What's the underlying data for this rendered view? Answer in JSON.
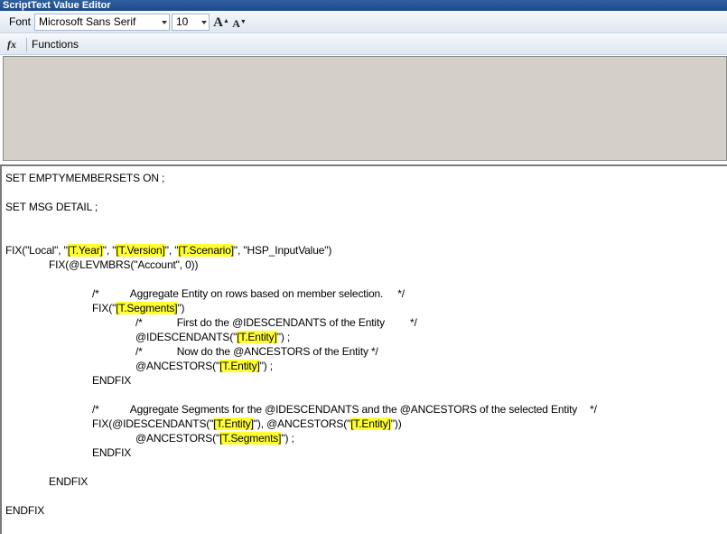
{
  "window": {
    "title": "ScriptText Value Editor"
  },
  "toolbar": {
    "font_label": "Font",
    "font_name": "Microsoft Sans Serif",
    "font_size": "10",
    "grow_label": "A",
    "shrink_label": "A",
    "fx_label": "fx",
    "functions_label": "Functions"
  },
  "script": {
    "l1": "SET EMPTYMEMBERSETS ON ;",
    "l2": "SET MSG DETAIL ;",
    "l3_a": "FIX(\"Local\", \"",
    "l3_b": "[T.Year]",
    "l3_c": "\", \"",
    "l3_d": "[T.Version]",
    "l3_e": "\", \"",
    "l3_f": "[T.Scenario]",
    "l3_g": "\", \"HSP_InputValue\")",
    "l4": "FIX(@LEVMBRS(\"Account\", 0))",
    "l5_a": "/*",
    "l5_b": "Aggregate Entity on rows based on member selection.",
    "l5_c": "*/",
    "l6_a": "FIX(\"",
    "l6_b": "[T.Segments]",
    "l6_c": "\")",
    "l7_a": "/*",
    "l7_b": "First do the @IDESCENDANTS of the Entity",
    "l7_c": "*/",
    "l8_a": "@IDESCENDANTS(\"",
    "l8_b": "[T.Entity]",
    "l8_c": "\") ;",
    "l9_a": "/*",
    "l9_b": "Now do the @ANCESTORS of the Entity */",
    "l10_a": "@ANCESTORS(\"",
    "l10_b": "[T.Entity]",
    "l10_c": "\") ;",
    "l11": "ENDFIX",
    "l12_a": "/*",
    "l12_b": "Aggregate Segments for the @IDESCENDANTS and the @ANCESTORS of the selected Entity",
    "l12_c": "*/",
    "l13_a": "FIX(@IDESCENDANTS(\"",
    "l13_b": "[T.Entity]",
    "l13_c": "\"), @ANCESTORS(\"",
    "l13_d": "[T.Entity]",
    "l13_e": "\"))",
    "l14_a": "@ANCESTORS(\"",
    "l14_b": "[T.Segments]",
    "l14_c": "\") ;",
    "l15": "ENDFIX",
    "l16": "ENDFIX",
    "l17": "ENDFIX"
  },
  "colors": {
    "highlight": "#ffff33",
    "title_bar": "#1d4a8a",
    "empty_pane": "#d4d0c8"
  }
}
